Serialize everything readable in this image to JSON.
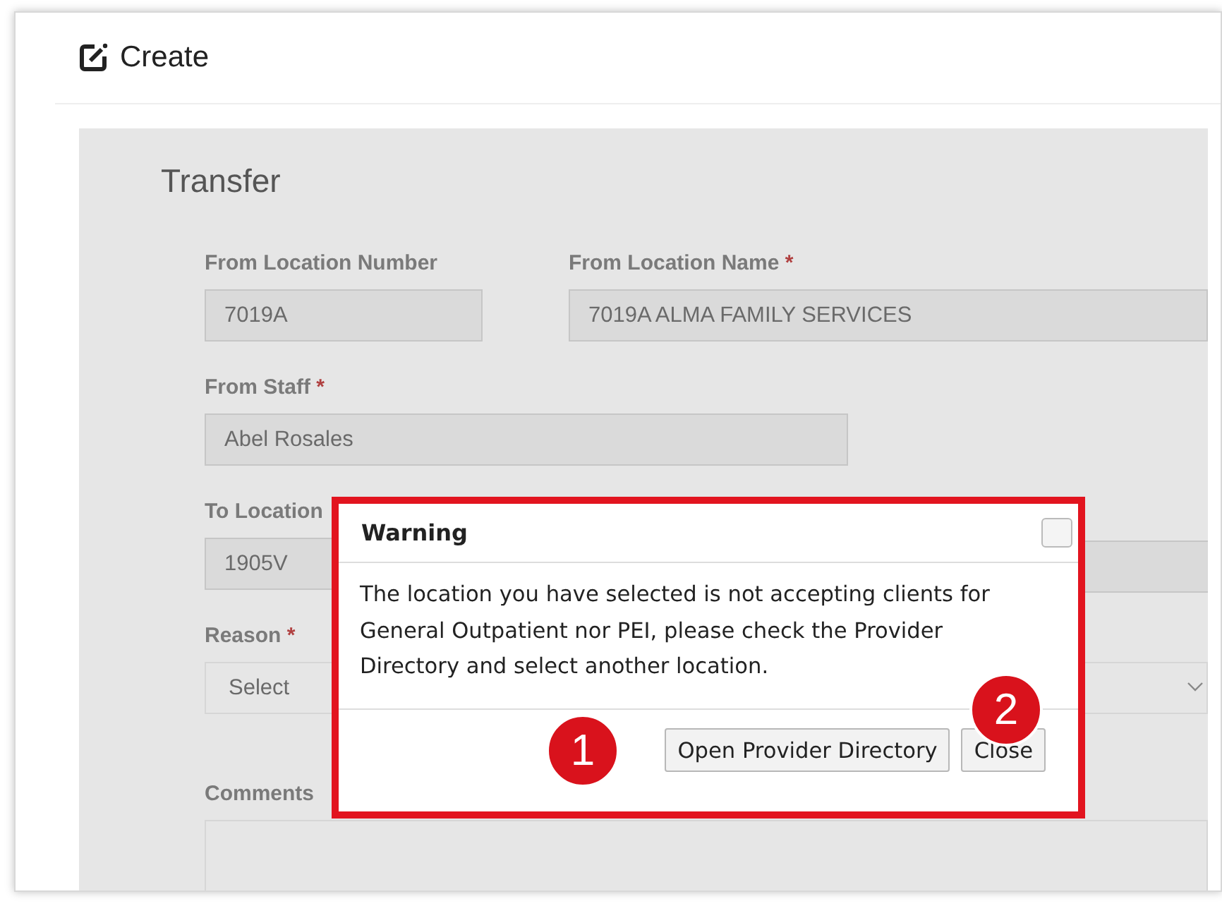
{
  "header": {
    "title": "Create"
  },
  "form": {
    "title": "Transfer",
    "fields": [
      {
        "label": "From Location Number",
        "value": "7019A",
        "kind": "text"
      },
      {
        "label": "From Location Name",
        "required_mark": "*",
        "value": "7019A ALMA FAMILY SERVICES",
        "kind": "text"
      },
      {
        "label": "From Staff",
        "required_mark": "*",
        "value": "Abel Rosales",
        "kind": "text"
      },
      {
        "label": "To Location",
        "value": "1905V",
        "kind": "text"
      },
      {
        "label": "Reason",
        "required_mark": "*",
        "value": "Select",
        "kind": "select"
      },
      {
        "label": "Comments",
        "kind": "textarea"
      }
    ]
  },
  "dialog": {
    "title": "Warning",
    "message": "The location you have selected is not accepting clients for General Outpatient nor PEI, please check the Provider Directory and select another location.",
    "buttons": [
      "Open Provider Directory",
      "Close"
    ]
  },
  "callouts": [
    {
      "label": "1"
    },
    {
      "label": "2"
    }
  ]
}
